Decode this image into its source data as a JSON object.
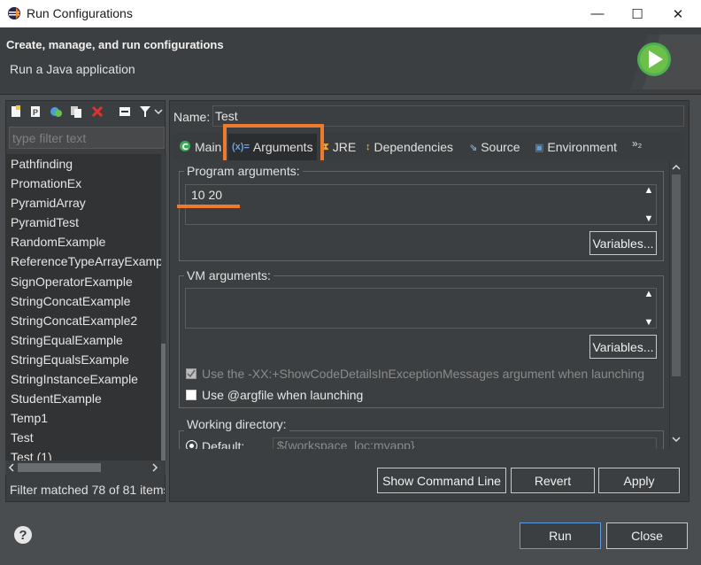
{
  "window": {
    "title": "Run Configurations",
    "minimize": "—",
    "maximize": "☐",
    "close": "✕"
  },
  "header": {
    "title": "Create, manage, and run configurations",
    "subtitle": "Run a Java application"
  },
  "left": {
    "filter_placeholder": "type filter text",
    "items": [
      "Pathfinding",
      "PromationEx",
      "PyramidArray",
      "PyramidTest",
      "RandomExample",
      "ReferenceTypeArrayExampl",
      "SignOperatorExample",
      "StringConcatExample",
      "StringConcatExample2",
      "StringEqualExample",
      "StringEqualsExample",
      "StringInstanceExample",
      "StudentExample",
      "Temp1",
      "Test",
      "Test (1)"
    ],
    "filter_status": "Filter matched 78 of 81 items"
  },
  "name": {
    "label": "Name:",
    "value": "Test"
  },
  "tabs": [
    {
      "label": "Main",
      "icon": "C"
    },
    {
      "label": "Arguments",
      "icon": "(x)="
    },
    {
      "label": "JRE",
      "icon": "⧗"
    },
    {
      "label": "Dependencies",
      "icon": "↕"
    },
    {
      "label": "Source",
      "icon": "⇘"
    },
    {
      "label": "Environment",
      "icon": "▣"
    },
    {
      "label": "»₂",
      "icon": ""
    }
  ],
  "program_args": {
    "legend": "Program arguments:",
    "value": "10 20",
    "variables": "Variables..."
  },
  "vm_args": {
    "legend": "VM arguments:",
    "value": "",
    "variables": "Variables..."
  },
  "options": {
    "show_code_details": "Use the -XX:+ShowCodeDetailsInExceptionMessages argument when launching",
    "argfile": "Use @argfile when launching"
  },
  "working_dir": {
    "legend": "Working directory:",
    "default_label": "Default:",
    "default_value": "${workspace_loc:myapp}"
  },
  "buttons": {
    "show_command_line": "Show Command Line",
    "revert": "Revert",
    "apply": "Apply",
    "run": "Run",
    "close": "Close"
  },
  "help": "?",
  "colors": {
    "accent": "#ee7a2e",
    "background": "#3c3f41"
  }
}
